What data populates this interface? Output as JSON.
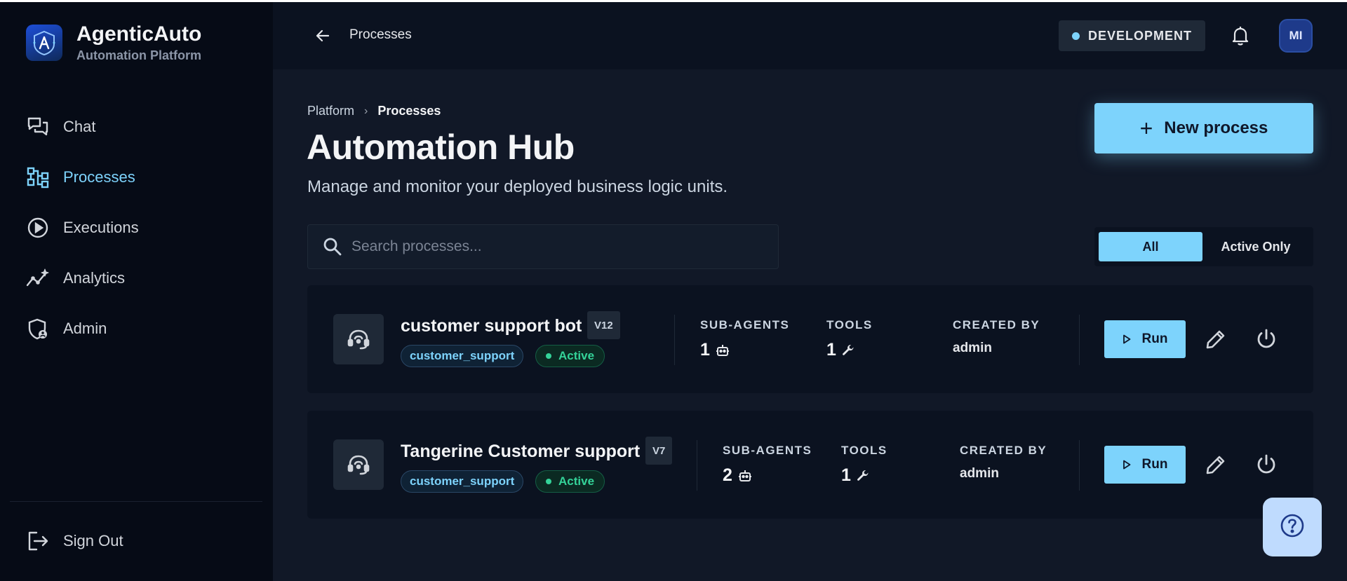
{
  "brand": {
    "name": "AgenticAuto",
    "subtitle": "Automation Platform"
  },
  "sidebar": {
    "items": [
      {
        "label": "Chat",
        "icon": "chat-icon"
      },
      {
        "label": "Processes",
        "icon": "processes-icon",
        "active": true
      },
      {
        "label": "Executions",
        "icon": "play-circle-icon"
      },
      {
        "label": "Analytics",
        "icon": "analytics-icon"
      },
      {
        "label": "Admin",
        "icon": "admin-shield-icon"
      }
    ],
    "sign_out": "Sign Out"
  },
  "header": {
    "title": "Processes",
    "environment": "DEVELOPMENT",
    "avatar_initials": "MI"
  },
  "main": {
    "breadcrumb": [
      "Platform",
      "Processes"
    ],
    "title": "Automation Hub",
    "subtitle": "Manage and monitor your deployed business logic units.",
    "new_button": "New process",
    "search_placeholder": "Search processes...",
    "filters": [
      "All",
      "Active Only"
    ],
    "active_filter": "All"
  },
  "labels": {
    "sub_agents": "SUB-AGENTS",
    "tools": "TOOLS",
    "created_by": "CREATED BY",
    "run": "Run"
  },
  "processes": [
    {
      "name": "customer support bot",
      "version": "V12",
      "tag": "customer_support",
      "status": "Active",
      "sub_agents": "1",
      "tools": "1",
      "created_by": "admin"
    },
    {
      "name": "Tangerine Customer support",
      "version": "V7",
      "tag": "customer_support",
      "status": "Active",
      "sub_agents": "2",
      "tools": "1",
      "created_by": "admin"
    }
  ],
  "colors": {
    "accent": "#7dd3fc",
    "active_green": "#34d399",
    "background": "#111827",
    "sidebar": "#060b16"
  }
}
